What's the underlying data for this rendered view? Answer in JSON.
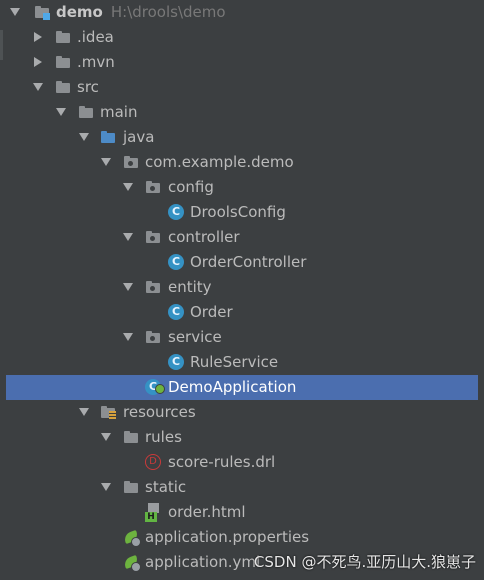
{
  "tree": {
    "root": {
      "label": "demo",
      "path": "H:\\drools\\demo"
    },
    "idea": ".idea",
    "mvn": ".mvn",
    "src": "src",
    "main": "main",
    "java": "java",
    "package": "com.example.demo",
    "config": "config",
    "drools_config": "DroolsConfig",
    "controller": "controller",
    "order_controller": "OrderController",
    "entity": "entity",
    "order": "Order",
    "service": "service",
    "rule_service": "RuleService",
    "demo_application": "DemoApplication",
    "resources": "resources",
    "rules": "rules",
    "score_rules": "score-rules.drl",
    "static": "static",
    "order_html": "order.html",
    "app_properties": "application.properties",
    "app_yml": "application.yml"
  },
  "icons": {
    "class_glyph": "C",
    "html_glyph": "H",
    "drl_glyph": "D"
  },
  "watermark": "CSDN @不死鸟.亚历山大.狼崽子",
  "colors": {
    "background": "#3c3f41",
    "selection": "#4b6eaf",
    "source_folder": "#4d8bc7",
    "class_icon": "#3592c4",
    "spring_green": "#6db33f"
  }
}
